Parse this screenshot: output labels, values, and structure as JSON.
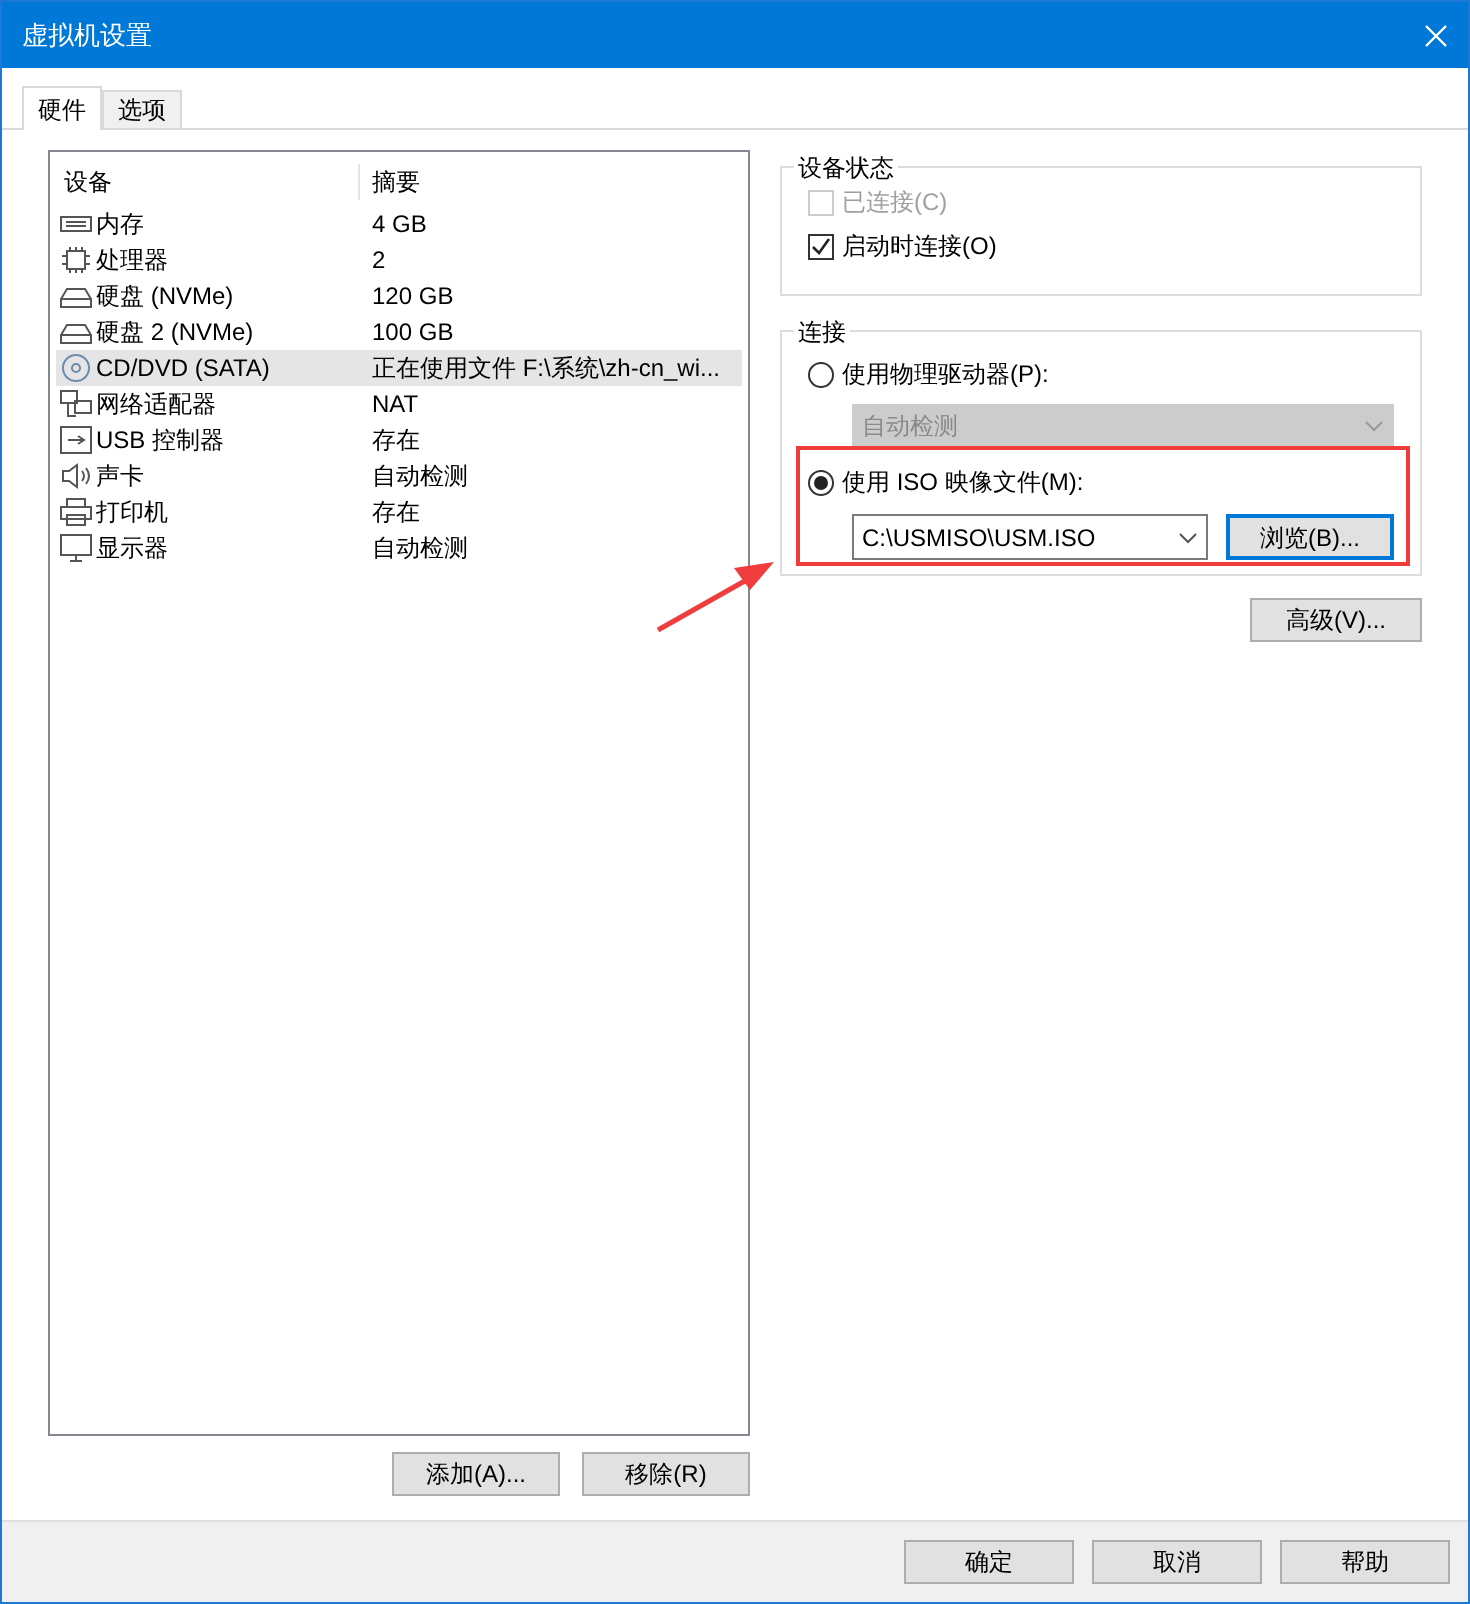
{
  "window": {
    "title": "虚拟机设置"
  },
  "tabs": [
    {
      "label": "硬件",
      "selected": true
    },
    {
      "label": "选项",
      "selected": false
    }
  ],
  "device_table": {
    "columns": [
      "设备",
      "摘要"
    ],
    "rows": [
      {
        "kind": "memory",
        "device": "内存",
        "summary": "4 GB",
        "selected": false
      },
      {
        "kind": "cpu",
        "device": "处理器",
        "summary": "2",
        "selected": false
      },
      {
        "kind": "disk",
        "device": "硬盘 (NVMe)",
        "summary": "120 GB",
        "selected": false
      },
      {
        "kind": "disk",
        "device": "硬盘 2 (NVMe)",
        "summary": "100 GB",
        "selected": false
      },
      {
        "kind": "cd",
        "device": "CD/DVD (SATA)",
        "summary": "正在使用文件 F:\\系统\\zh-cn_wi...",
        "selected": true
      },
      {
        "kind": "network",
        "device": "网络适配器",
        "summary": "NAT",
        "selected": false
      },
      {
        "kind": "usb",
        "device": "USB 控制器",
        "summary": "存在",
        "selected": false
      },
      {
        "kind": "sound",
        "device": "声卡",
        "summary": "自动检测",
        "selected": false
      },
      {
        "kind": "printer",
        "device": "打印机",
        "summary": "存在",
        "selected": false
      },
      {
        "kind": "display",
        "device": "显示器",
        "summary": "自动检测",
        "selected": false
      }
    ]
  },
  "list_buttons": [
    "添加(A)...",
    "移除(R)"
  ],
  "device_status": {
    "title": "设备状态",
    "options": [
      {
        "label": "已连接(C)",
        "checked": false,
        "disabled": true
      },
      {
        "label": "启动时连接(O)",
        "checked": true,
        "disabled": false
      }
    ]
  },
  "connection": {
    "title": "连接",
    "physical": {
      "label": "使用物理驱动器(P):",
      "selected": false,
      "dropdown": {
        "value": "自动检测",
        "disabled": true
      }
    },
    "iso": {
      "label": "使用 ISO 映像文件(M):",
      "selected": true,
      "path": "C:\\USMISO\\USM.ISO",
      "browse": "浏览(B)..."
    }
  },
  "advanced_button": "高级(V)...",
  "dialog_buttons": [
    "确定",
    "取消",
    "帮助"
  ]
}
